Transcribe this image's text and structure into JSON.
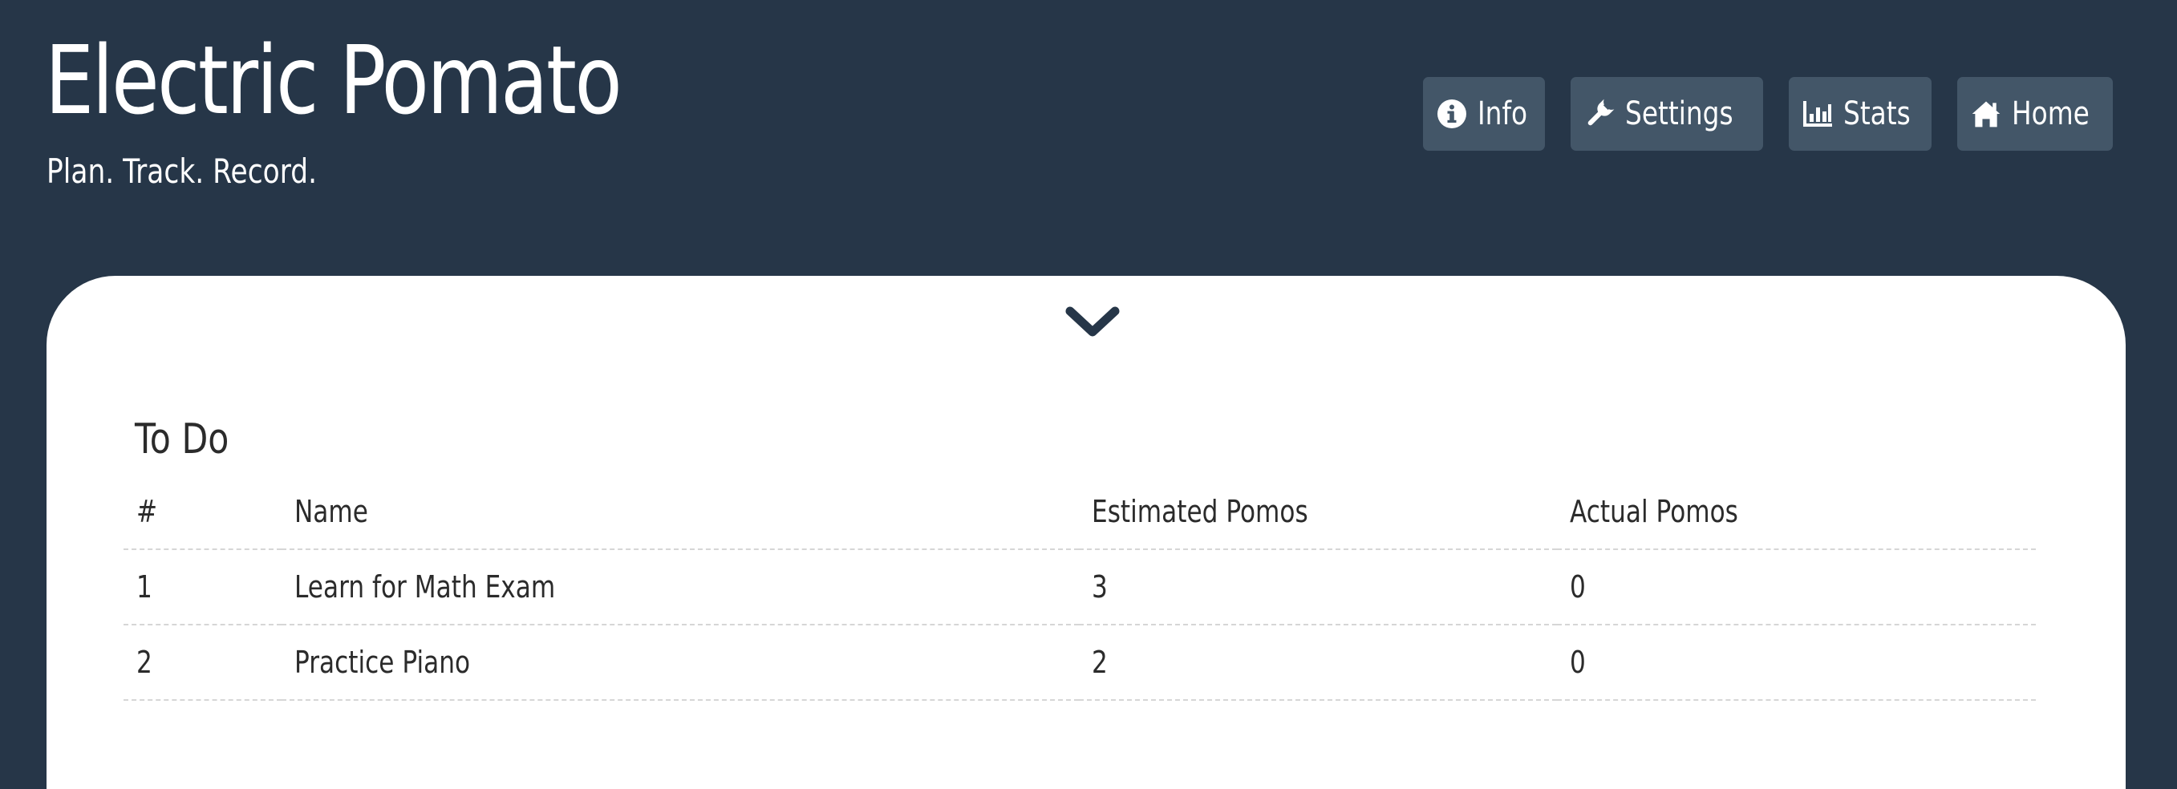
{
  "header": {
    "title": "Electric Pomato",
    "tagline": "Plan. Track. Record."
  },
  "nav": [
    {
      "label": "Info",
      "icon": "info-circle-icon"
    },
    {
      "label": "Settings",
      "icon": "wrench-icon"
    },
    {
      "label": "Stats",
      "icon": "bar-chart-icon"
    },
    {
      "label": "Home",
      "icon": "home-icon"
    }
  ],
  "panel": {
    "toggle_icon": "chevron-down-icon",
    "section_title": "To Do",
    "columns": [
      "#",
      "Name",
      "Estimated Pomos",
      "Actual Pomos"
    ],
    "rows": [
      {
        "num": "1",
        "name": "Learn for Math Exam",
        "estimated": "3",
        "actual": "0"
      },
      {
        "num": "2",
        "name": "Practice Piano",
        "estimated": "2",
        "actual": "0"
      }
    ]
  },
  "colors": {
    "background": "#263648",
    "button": "#435668",
    "panel": "#ffffff",
    "text_dark": "#2b2b2b"
  }
}
